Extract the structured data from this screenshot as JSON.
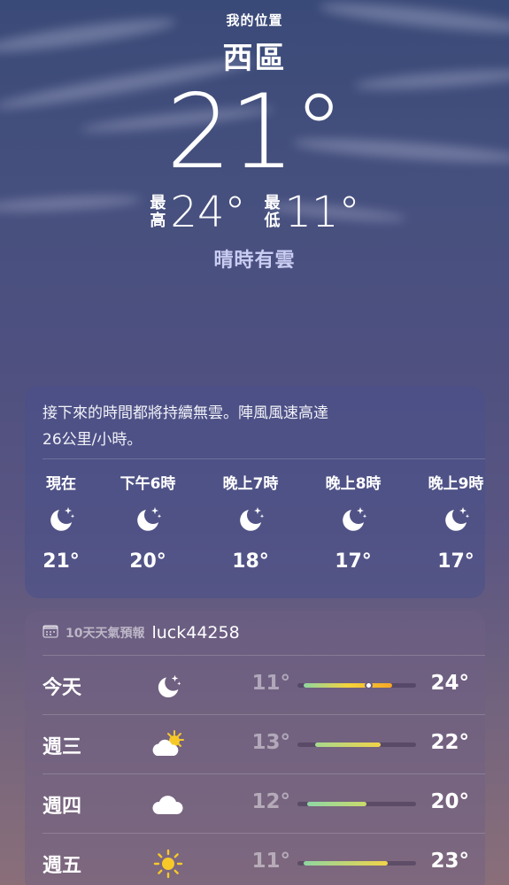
{
  "header": {
    "location_label": "我的位置",
    "city": "西區",
    "current_temp": "21°",
    "high_label": "最高",
    "high_value": "24°",
    "low_label": "最低",
    "low_value": "11°",
    "condition": "晴時有雲"
  },
  "hourly": {
    "summary_line1": "接下來的時間都將持續無雲。陣風風速高達",
    "summary_line2": "26公里/小時。",
    "hours": [
      {
        "label": "現在",
        "icon": "moon-stars-icon",
        "temp": "21°"
      },
      {
        "label": "下午6時",
        "icon": "moon-stars-icon",
        "temp": "20°"
      },
      {
        "label": "晚上7時",
        "icon": "moon-stars-icon",
        "temp": "18°"
      },
      {
        "label": "晚上8時",
        "icon": "moon-stars-icon",
        "temp": "17°"
      },
      {
        "label": "晚上9時",
        "icon": "moon-stars-icon",
        "temp": "17°"
      }
    ]
  },
  "daily": {
    "title": "10天天氣預報",
    "user": "luck44258",
    "days": [
      {
        "name": "今天",
        "icon": "moon-stars-icon",
        "low": "11°",
        "high": "24°",
        "range_start": 0.05,
        "range_end": 0.8,
        "current": 0.6,
        "colors": [
          "#8fd6a0",
          "#f4d43c",
          "#f6a623"
        ]
      },
      {
        "name": "週三",
        "icon": "cloud-sun-icon",
        "low": "13°",
        "high": "22°",
        "range_start": 0.15,
        "range_end": 0.7,
        "colors": [
          "#a6d98e",
          "#f1d448"
        ]
      },
      {
        "name": "週四",
        "icon": "cloud-icon",
        "low": "12°",
        "high": "20°",
        "range_start": 0.08,
        "range_end": 0.58,
        "colors": [
          "#8ed7a6",
          "#c9dc6a"
        ]
      },
      {
        "name": "週五",
        "icon": "sun-icon",
        "low": "11°",
        "high": "23°",
        "range_start": 0.05,
        "range_end": 0.76,
        "colors": [
          "#8fd6a0",
          "#f1d448"
        ]
      }
    ]
  },
  "colors": {
    "condition_text": "#c9cdf2",
    "sun": "#f7c928"
  }
}
